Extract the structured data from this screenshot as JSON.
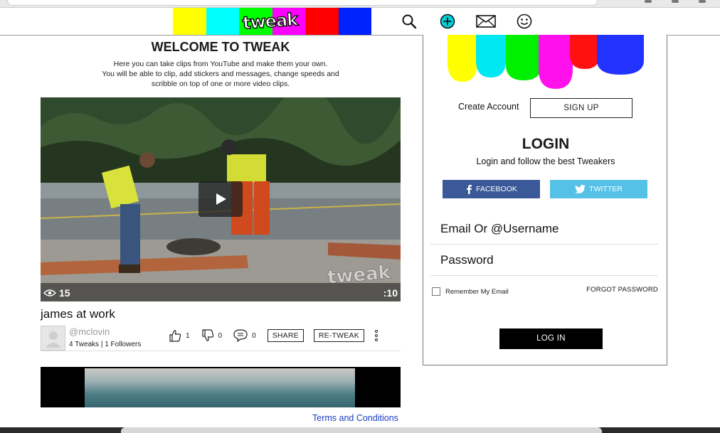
{
  "header": {
    "logo_text": "tweak",
    "bar_colors": [
      "#ffff00",
      "#00ffff",
      "#00ff00",
      "#ff00ff",
      "#ff0000",
      "#0000ff",
      "#0033ff"
    ],
    "icons": [
      "search-icon",
      "add-circle-icon",
      "mail-icon",
      "smiley-icon"
    ],
    "accent": "#00c8d7"
  },
  "welcome": {
    "title": "WELCOME TO TWEAK",
    "line1": "Here you can take clips from YouTube and make them your own.",
    "line2": "You will be able to clip, add stickers and messages, change speeds and",
    "line3": "scribble on top of one or more video clips."
  },
  "clip": {
    "views": "15",
    "duration": ":10",
    "watermark": "tweak",
    "title": "james at work",
    "username": "@mclovin",
    "tweaks": "4 Tweaks",
    "followers": "1 Followers",
    "likes": "1",
    "dislikes": "0",
    "comments": "0",
    "share_label": "SHARE",
    "retweak_label": "RE-TWEAK"
  },
  "footer": {
    "terms": "Terms and Conditions"
  },
  "panel": {
    "create_account": "Create Account",
    "signup_label": "SIGN UP",
    "login_title": "LOGIN",
    "login_sub": "Login and follow the best Tweakers",
    "facebook_label": "FACEBOOK",
    "twitter_label": "TWITTER",
    "email_placeholder": "Email Or @Username",
    "password_placeholder": "Password",
    "remember_label": "Remember My Email",
    "forgot_label": "FORGOT PASSWORD",
    "login_button": "LOG IN",
    "facebook_color": "#3b5998",
    "twitter_color": "#55c1e7"
  }
}
